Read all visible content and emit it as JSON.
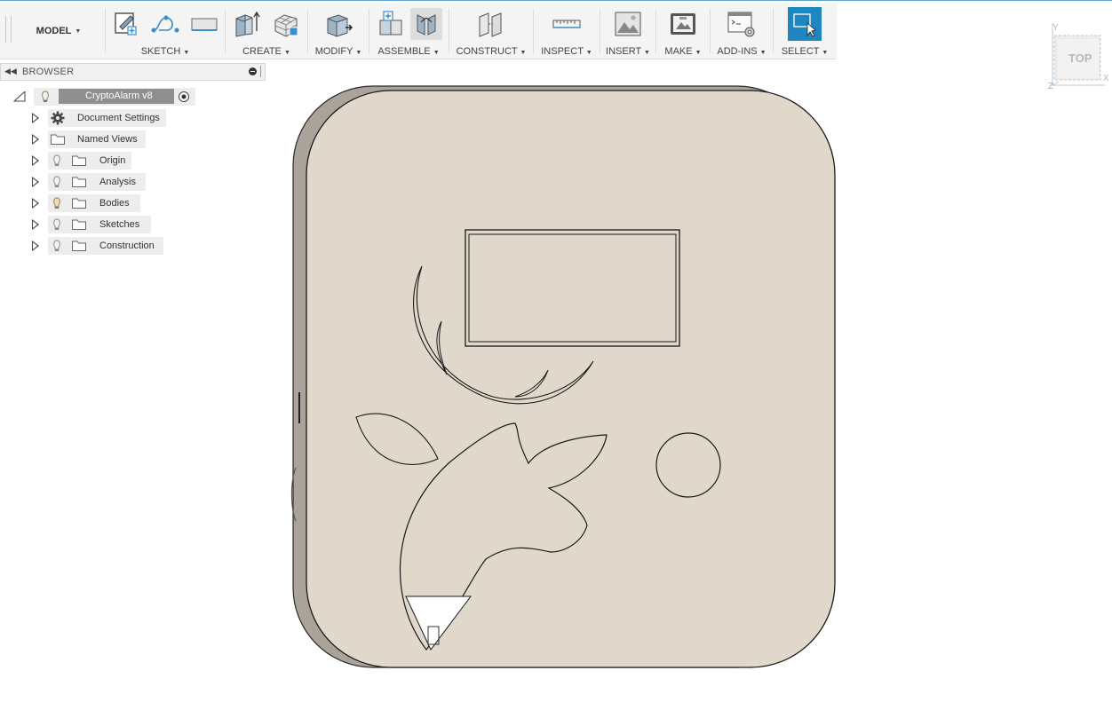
{
  "toolbar": {
    "model_label": "MODEL",
    "groups": [
      {
        "label": "SKETCH",
        "icons": [
          "create-sketch-icon",
          "spline-icon",
          "rectangle-icon"
        ]
      },
      {
        "label": "CREATE",
        "icons": [
          "extrude-icon",
          "create-form-icon"
        ]
      },
      {
        "label": "MODIFY",
        "icons": [
          "press-pull-icon"
        ]
      },
      {
        "label": "ASSEMBLE",
        "icons": [
          "new-component-icon",
          "joint-icon"
        ]
      },
      {
        "label": "CONSTRUCT",
        "icons": [
          "offset-plane-icon"
        ]
      },
      {
        "label": "INSPECT",
        "icons": [
          "measure-icon"
        ]
      },
      {
        "label": "INSERT",
        "icons": [
          "insert-image-icon"
        ]
      },
      {
        "label": "MAKE",
        "icons": [
          "print-3d-icon"
        ]
      },
      {
        "label": "ADD-INS",
        "icons": [
          "scripts-icon"
        ]
      },
      {
        "label": "SELECT",
        "icons": [
          "select-window-icon"
        ]
      }
    ]
  },
  "browser": {
    "title": "BROWSER",
    "root": {
      "label": "CryptoAlarm v8"
    },
    "items": [
      {
        "label": "Document Settings",
        "icon": "gear-icon",
        "bulb": false
      },
      {
        "label": "Named Views",
        "icon": "folder-icon",
        "bulb": false
      },
      {
        "label": "Origin",
        "icon": "folder-icon",
        "bulb": true
      },
      {
        "label": "Analysis",
        "icon": "folder-icon",
        "bulb": true
      },
      {
        "label": "Bodies",
        "icon": "folder-icon",
        "bulb": true
      },
      {
        "label": "Sketches",
        "icon": "folder-icon",
        "bulb": true
      },
      {
        "label": "Construction",
        "icon": "folder-icon",
        "bulb": true
      }
    ]
  },
  "viewcube": {
    "face_label": "TOP",
    "axes": {
      "y": "Y",
      "x": "X",
      "z": "Z"
    }
  },
  "colors": {
    "accent": "#1f86bf",
    "model_face": "#e0d8cb",
    "model_side": "#a9a39a",
    "toolbar_bg": "#f4f4f4"
  }
}
